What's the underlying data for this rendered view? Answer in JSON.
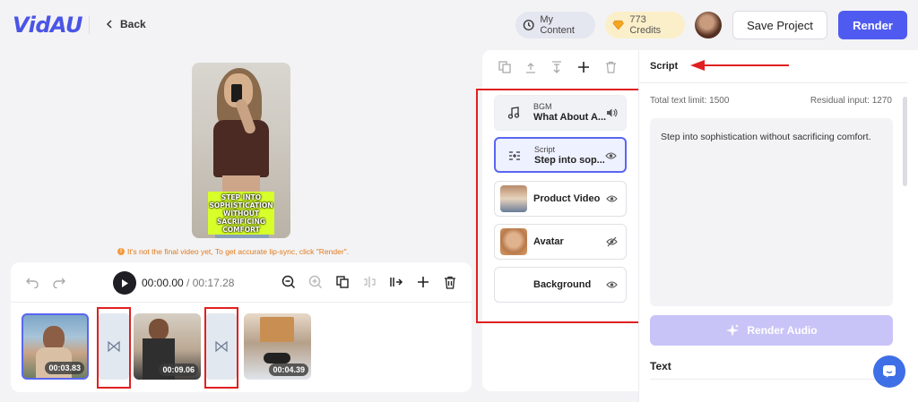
{
  "header": {
    "logo": "VidAU",
    "back_label": "Back",
    "my_content_label": "My Content",
    "credits_label": "773 Credits",
    "save_label": "Save Project",
    "render_label": "Render"
  },
  "preview": {
    "caption": "STEP INTO SOPHISTICATION WITHOUT SACRIFICING COMFORT",
    "notice": "It's not the final video yet, To get accurate lip-sync, click \"Render\"."
  },
  "player": {
    "current_time": "00:00.00",
    "separator": " / ",
    "total_time": "00:17.28"
  },
  "timeline": {
    "clips": [
      {
        "duration": "00:03.83"
      },
      {
        "duration": "00:09.06"
      },
      {
        "duration": "00:04.39"
      }
    ]
  },
  "layers": [
    {
      "sub": "BGM",
      "title": "What About A...",
      "right_icon": "volume-icon"
    },
    {
      "sub": "Script",
      "title": "Step into sop...",
      "right_icon": "eye-icon"
    },
    {
      "title": "Product Video",
      "right_icon": "eye-icon"
    },
    {
      "title": "Avatar",
      "right_icon": "eye-off-icon"
    },
    {
      "title": "Background",
      "right_icon": "eye-icon"
    }
  ],
  "script_panel": {
    "title": "Script",
    "limit_label": "Total text limit: 1500",
    "residual_label": "Residual input: 1270",
    "script_text": "Step into sophistication without sacrificing comfort.",
    "render_audio_label": "Render Audio",
    "text_heading": "Text"
  },
  "colors": {
    "accent": "#4f5bf0",
    "annotation_red": "#e02020",
    "caption_bg": "#d7ff2a",
    "notice": "#e07b1c"
  }
}
